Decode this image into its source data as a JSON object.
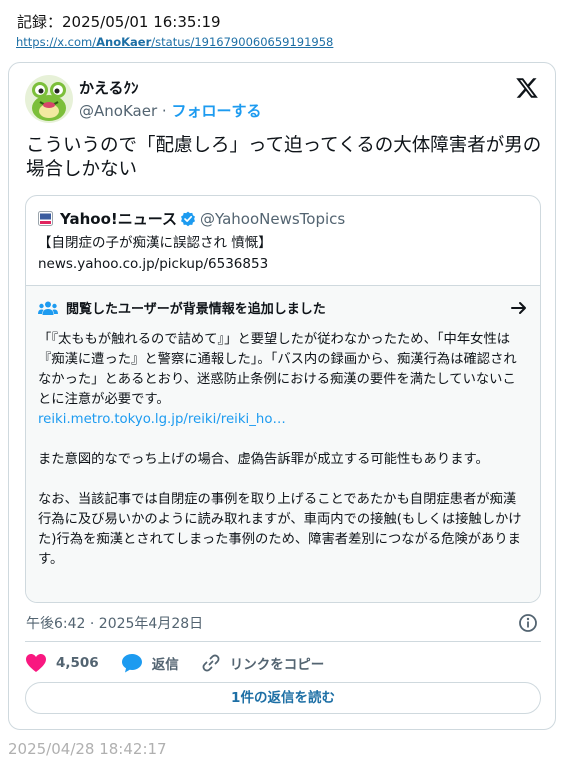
{
  "record": {
    "header": "記録：2025/05/01 16:35:19",
    "url_prefix": "https://x.com/",
    "url_user": "AnoKaer",
    "url_suffix": "/status/1916790060659191958"
  },
  "tweet": {
    "display_name": "かえるｸﾝ",
    "handle": "@AnoKaer",
    "separator": "·",
    "follow_label": "フォローする",
    "text": "こういうので「配慮しろ」って迫ってくるの大体障害者が男の場合しかない",
    "timestamp": "午後6:42 · 2025年4月28日",
    "likes": "4,506",
    "reply_label": "返信",
    "copy_link_label": "リンクをコピー",
    "read_replies_label": "1件の返信を読む"
  },
  "quote": {
    "source_name": "Yahoo!ニュース",
    "source_handle": "@YahooNewsTopics",
    "title": "【自閉症の子が痴漢に誤認され 憤慨】",
    "domain": "news.yahoo.co.jp/pickup/6536853"
  },
  "community_note": {
    "header": "閲覧したユーザーが背景情報を追加しました",
    "paragraph1": "「『太ももが触れるので詰めて』」と要望したが従わなかったため、「中年女性は『痴漢に遭った』と警察に通報した」。「バス内の録画から、痴漢行為は確認されなかった」とあるとおり、迷惑防止条例における痴漢の要件を満たしていないことに注意が必要です。",
    "link": "reiki.metro.tokyo.lg.jp/reiki/reiki_ho…",
    "paragraph2": "また意図的なでっち上げの場合、虚偽告訴罪が成立する可能性もあります。",
    "paragraph3": "なお、当該記事では自閉症の事例を取り上げることであたかも自閉症患者が痴漢行為に及び易いかのように読み取れますが、車両内での接触(もしくは接触しかけた)行為を痴漢とされてしまった事例のため、障害者差別につながる危険があります。"
  },
  "footer": {
    "date": "2025/04/28 18:42:17"
  },
  "icons": {
    "x_logo": "x-logo-icon",
    "verified": "verified-badge-icon",
    "people": "people-icon",
    "arrow": "arrow-right-icon",
    "info": "info-icon",
    "heart": "heart-icon",
    "reply": "reply-bubble-icon",
    "link": "link-icon"
  },
  "colors": {
    "accent": "#1d9bf0",
    "like": "#f91880",
    "muted": "#536471",
    "border": "#cfd9de"
  }
}
